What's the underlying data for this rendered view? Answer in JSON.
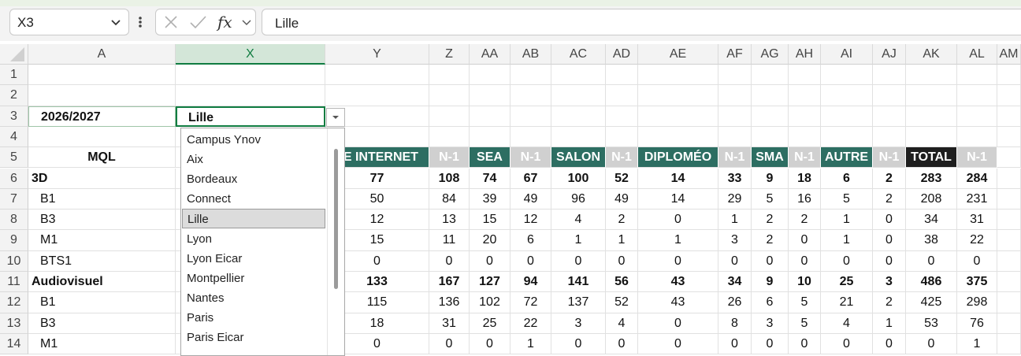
{
  "name_box": {
    "value": "X3"
  },
  "formula_bar": {
    "value": "Lille",
    "cancel_icon": "x-icon",
    "enter_icon": "check-icon",
    "fx_label": "fx"
  },
  "columns": [
    "A",
    "X",
    "Y",
    "Z",
    "AA",
    "AB",
    "AC",
    "AD",
    "AE",
    "AF",
    "AG",
    "AH",
    "AI",
    "AJ",
    "AK",
    "AL",
    "AM"
  ],
  "selected_column": "X",
  "rows": [
    "1",
    "2",
    "3",
    "4",
    "5",
    "6",
    "7",
    "8",
    "9",
    "10",
    "11",
    "12",
    "13",
    "14"
  ],
  "cells": {
    "a3": "2026/2027",
    "x3": "Lille",
    "a5": "MQL"
  },
  "header_row": [
    "TE INTERNET",
    "N-1",
    "SEA",
    "N-1",
    "SALON",
    "N-1",
    "DIPLOMÉO",
    "N-1",
    "SMA",
    "N-1",
    "AUTRE",
    "N-1",
    "TOTAL",
    "N-1"
  ],
  "data_rows": [
    {
      "label": "3D",
      "bold": true,
      "values": [
        "77",
        "108",
        "74",
        "67",
        "100",
        "52",
        "14",
        "33",
        "9",
        "18",
        "6",
        "2",
        "283",
        "284"
      ]
    },
    {
      "label": "B1",
      "bold": false,
      "values": [
        "50",
        "84",
        "39",
        "49",
        "96",
        "49",
        "14",
        "29",
        "5",
        "16",
        "5",
        "2",
        "208",
        "231"
      ]
    },
    {
      "label": "B3",
      "bold": false,
      "values": [
        "12",
        "13",
        "15",
        "12",
        "4",
        "2",
        "0",
        "1",
        "2",
        "2",
        "1",
        "0",
        "34",
        "31"
      ]
    },
    {
      "label": "M1",
      "bold": false,
      "values": [
        "15",
        "11",
        "20",
        "6",
        "1",
        "1",
        "1",
        "3",
        "2",
        "0",
        "1",
        "0",
        "38",
        "22"
      ]
    },
    {
      "label": "BTS1",
      "bold": false,
      "values": [
        "0",
        "0",
        "0",
        "0",
        "0",
        "0",
        "0",
        "0",
        "0",
        "0",
        "0",
        "0",
        "0",
        "0"
      ]
    },
    {
      "label": "Audiovisuel",
      "bold": true,
      "values": [
        "133",
        "167",
        "127",
        "94",
        "141",
        "56",
        "43",
        "34",
        "9",
        "10",
        "25",
        "3",
        "486",
        "375"
      ]
    },
    {
      "label": "B1",
      "bold": false,
      "values": [
        "115",
        "136",
        "102",
        "72",
        "137",
        "52",
        "43",
        "26",
        "6",
        "5",
        "21",
        "2",
        "425",
        "298"
      ]
    },
    {
      "label": "B3",
      "bold": false,
      "values": [
        "18",
        "31",
        "25",
        "22",
        "3",
        "4",
        "0",
        "8",
        "3",
        "5",
        "4",
        "1",
        "53",
        "76"
      ]
    },
    {
      "label": "M1",
      "bold": false,
      "values": [
        "0",
        "0",
        "0",
        "1",
        "0",
        "0",
        "0",
        "0",
        "0",
        "0",
        "0",
        "0",
        "0",
        "1"
      ]
    }
  ],
  "dropdown": {
    "items": [
      "Campus Ynov",
      "Aix",
      "Bordeaux",
      "Connect",
      "Lille",
      "Lyon",
      "Lyon Eicar",
      "Montpellier",
      "Nantes",
      "Paris",
      "Paris Eicar"
    ],
    "selected": "Lille"
  },
  "colors": {
    "teal": "#2d6e62",
    "grey": "#d0d0d0",
    "black": "#1e1e1e",
    "accent": "#107c41"
  }
}
